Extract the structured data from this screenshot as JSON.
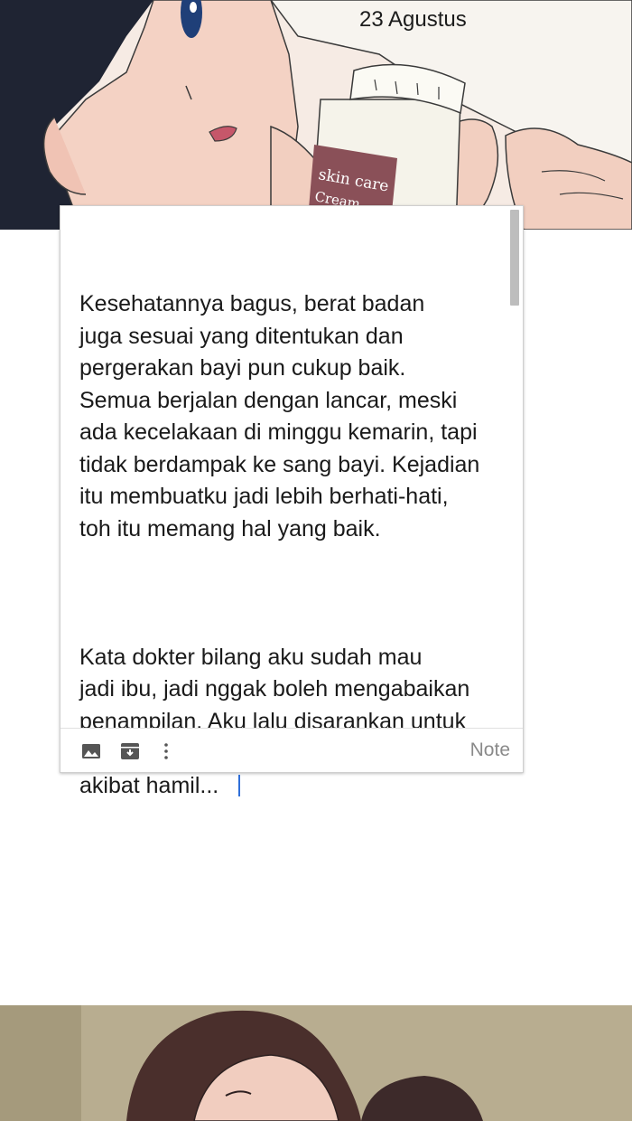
{
  "top_panel": {
    "date": "23 Agustus",
    "jar_label_line1": "skin care",
    "jar_label_line2": "Cream"
  },
  "note": {
    "paragraph1": "Kesehatannya bagus, berat badan\njuga sesuai yang ditentukan dan\npergerakan bayi pun cukup baik.\nSemua berjalan dengan lancar, meski\nada kecelakaan di minggu kemarin, tapi\ntidak berdampak ke sang bayi. Kejadian\nitu membuatku jadi lebih berhati-hati,\ntoh itu memang hal yang baik.",
    "paragraph2": "Kata dokter bilang aku sudah mau\njadi ibu, jadi nggak boleh mengabaikan\npenampilan. Aku lalu disarankan untuk\npakai krim penecegah stretch marks\nakibat hamil...",
    "type_label": "Note",
    "toolbar_icons": [
      "image-icon",
      "archive-icon",
      "more-vertical-icon"
    ]
  },
  "colors": {
    "cursor": "#2f6fd8",
    "hair": "#1f2433",
    "jar_label": "#8a5058"
  }
}
